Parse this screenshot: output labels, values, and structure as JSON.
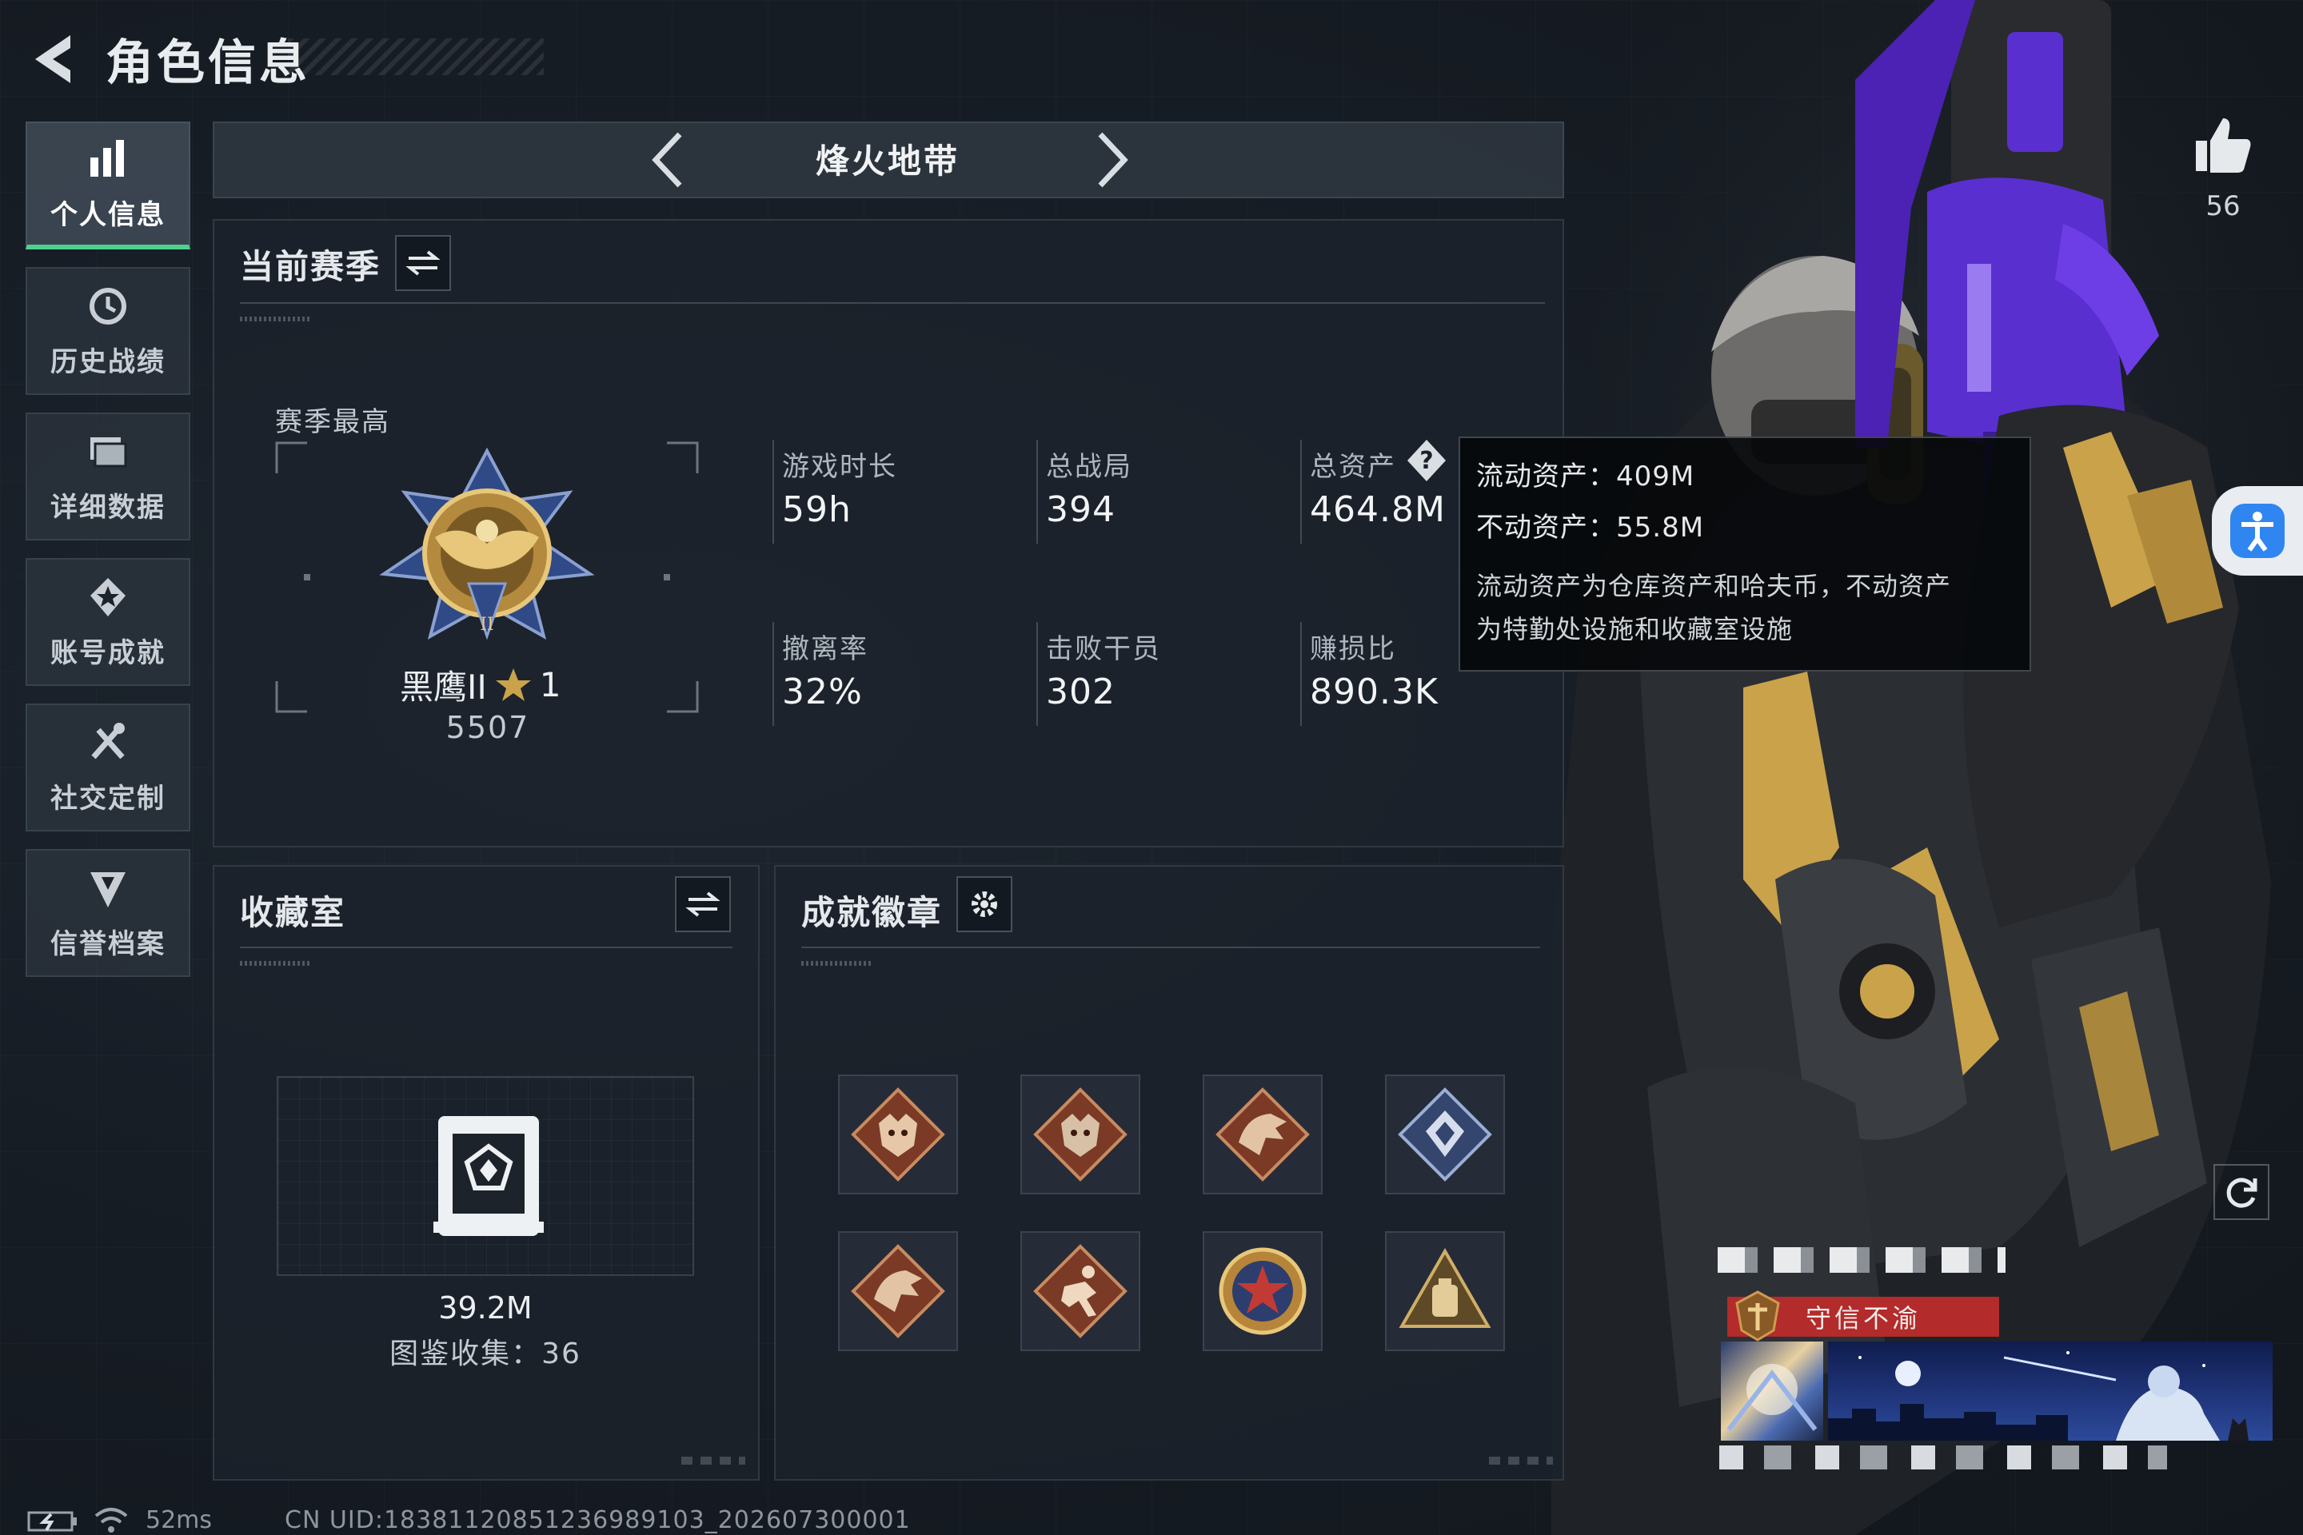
{
  "header": {
    "title": "角色信息"
  },
  "sidebar": {
    "items": [
      {
        "label": "个人信息",
        "icon": "bar-chart-icon",
        "active": true
      },
      {
        "label": "历史战绩",
        "icon": "history-clock-icon",
        "active": false
      },
      {
        "label": "详细数据",
        "icon": "folder-icon",
        "active": false
      },
      {
        "label": "账号成就",
        "icon": "achievement-star-icon",
        "active": false
      },
      {
        "label": "社交定制",
        "icon": "tools-icon",
        "active": false
      },
      {
        "label": "信誉档案",
        "icon": "reputation-shield-icon",
        "active": false
      }
    ]
  },
  "mode": {
    "name": "烽火地带"
  },
  "season": {
    "title": "当前赛季",
    "best_label": "赛季最高",
    "rank_name": "黑鹰II",
    "rank_stars": "1",
    "rank_score": "5507",
    "stats": [
      {
        "label": "游戏时长",
        "value": "59h"
      },
      {
        "label": "总战局",
        "value": "394"
      },
      {
        "label": "总资产",
        "value": "464.8M"
      },
      {
        "label": "撤离率",
        "value": "32%"
      },
      {
        "label": "击败干员",
        "value": "302"
      },
      {
        "label": "赚损比",
        "value": "890.3K"
      }
    ]
  },
  "tooltip": {
    "liquid": "流动资产：409M",
    "fixed": "不动资产：55.8M",
    "desc_line1": "流动资产为仓库资产和哈夫币，不动资产",
    "desc_line2": "为特勤处设施和收藏室设施"
  },
  "collection": {
    "title": "收藏室",
    "value": "39.2M",
    "count_label": "图鉴收集：36"
  },
  "achievements": {
    "title": "成就徽章",
    "badges": [
      "wolf-badge-icon",
      "wolf-badge-icon",
      "dragon-badge-icon",
      "diamond-badge-icon",
      "dragon-badge-icon",
      "runner-badge-icon",
      "star-medal-icon",
      "backpack-badge-icon"
    ]
  },
  "likes": {
    "count": "56"
  },
  "profile": {
    "motto": "守信不渝"
  },
  "status": {
    "ping": "52ms",
    "uid": "CN UID:18381120851236989103_202607300001"
  },
  "colors": {
    "accent_green": "#4fd08c",
    "weapon_purple": "#5a2fd0",
    "gold": "#c9a24a",
    "motto_red": "#b32b2b",
    "accessibility_blue": "#2f86f0"
  }
}
